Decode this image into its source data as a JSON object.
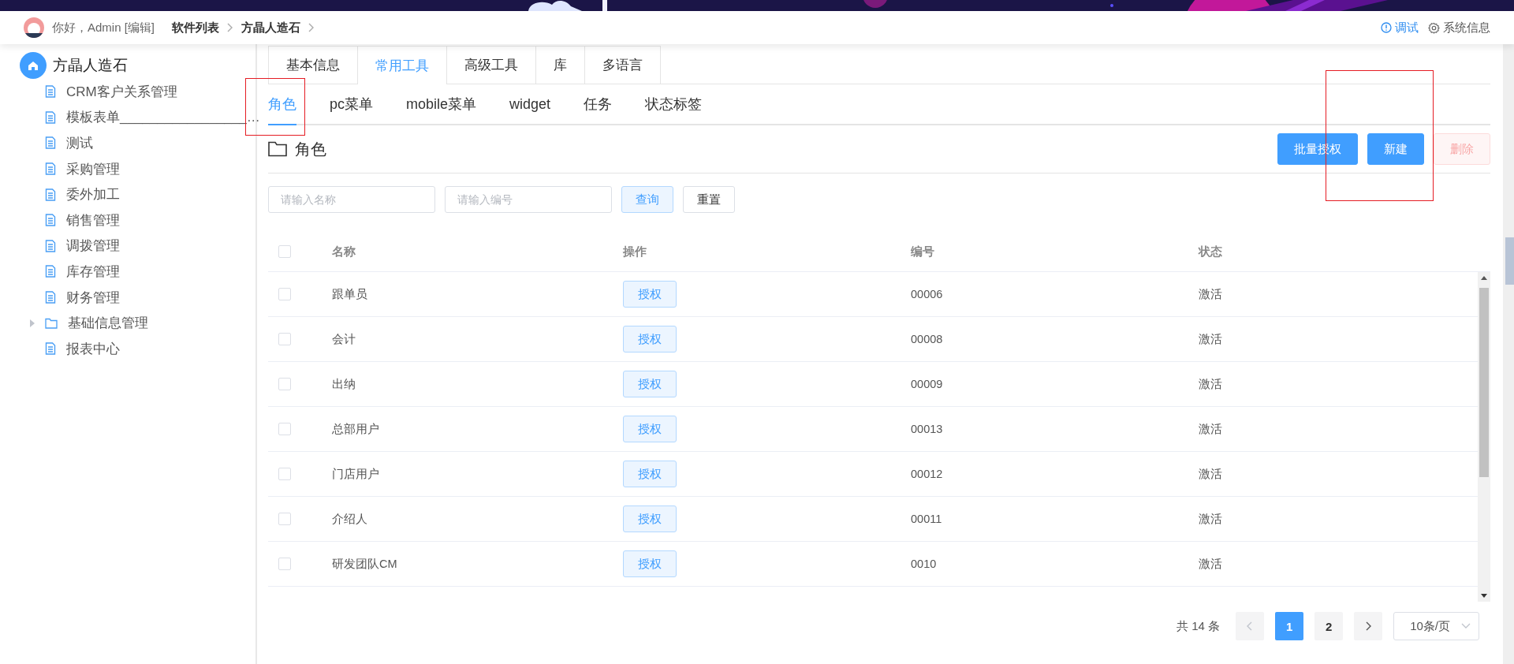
{
  "header": {
    "greeting": "你好，Admin [编辑]",
    "breadcrumb": [
      {
        "label": "软件列表"
      },
      {
        "label": "方晶人造石"
      }
    ],
    "actions": [
      {
        "kind": "info",
        "label": "调试"
      },
      {
        "kind": "gear",
        "label": "系统信息"
      }
    ]
  },
  "sidebar": {
    "root": "方晶人造石",
    "items": [
      {
        "kind": "file",
        "label": "CRM客户关系管理"
      },
      {
        "kind": "file",
        "label": "模板表单_________________…"
      },
      {
        "kind": "file",
        "label": "测试"
      },
      {
        "kind": "file",
        "label": "采购管理"
      },
      {
        "kind": "file",
        "label": "委外加工"
      },
      {
        "kind": "file",
        "label": "销售管理"
      },
      {
        "kind": "file",
        "label": "调拨管理"
      },
      {
        "kind": "file",
        "label": "库存管理"
      },
      {
        "kind": "file",
        "label": "财务管理"
      },
      {
        "kind": "folder",
        "label": "基础信息管理",
        "expanded": false
      },
      {
        "kind": "file",
        "label": "报表中心"
      }
    ]
  },
  "tabs": [
    {
      "label": "基本信息",
      "selected": false
    },
    {
      "label": "常用工具",
      "selected": true
    },
    {
      "label": "高级工具",
      "selected": false
    },
    {
      "label": "库",
      "selected": false
    },
    {
      "label": "多语言",
      "selected": false
    }
  ],
  "subtabs": [
    {
      "label": "角色",
      "selected": true
    },
    {
      "label": "pc菜单",
      "selected": false
    },
    {
      "label": "mobile菜单",
      "selected": false
    },
    {
      "label": "widget",
      "selected": false
    },
    {
      "label": "任务",
      "selected": false
    },
    {
      "label": "状态标签",
      "selected": false
    }
  ],
  "panel": {
    "title": "角色",
    "buttons": [
      {
        "kind": "primary",
        "label": "批量授权"
      },
      {
        "kind": "primary",
        "label": "新建"
      },
      {
        "kind": "danger",
        "label": "删除",
        "disabled": true
      }
    ]
  },
  "filters": {
    "fields": [
      {
        "placeholder": "请输入名称"
      },
      {
        "placeholder": "请输入编号"
      }
    ],
    "buttons": [
      {
        "kind": "query",
        "label": "查询"
      },
      {
        "kind": "plain",
        "label": "重置"
      }
    ]
  },
  "table": {
    "select_all_checked": false,
    "columns": [
      "名称",
      "操作",
      "编号",
      "状态"
    ],
    "rows": [
      {
        "checked": false,
        "name": "跟单员",
        "action": "授权",
        "code": "00006",
        "status": "激活"
      },
      {
        "checked": false,
        "name": "会计",
        "action": "授权",
        "code": "00008",
        "status": "激活"
      },
      {
        "checked": false,
        "name": "出纳",
        "action": "授权",
        "code": "00009",
        "status": "激活"
      },
      {
        "checked": false,
        "name": "总部用户",
        "action": "授权",
        "code": "00013",
        "status": "激活"
      },
      {
        "checked": false,
        "name": "门店用户",
        "action": "授权",
        "code": "00012",
        "status": "激活"
      },
      {
        "checked": false,
        "name": "介绍人",
        "action": "授权",
        "code": "00011",
        "status": "激活"
      },
      {
        "checked": false,
        "name": "研发团队CM",
        "action": "授权",
        "code": "0010",
        "status": "激活"
      }
    ]
  },
  "pagination": {
    "total": "共 14 条",
    "pages": [
      {
        "label": "1",
        "selected": true
      },
      {
        "label": "2",
        "selected": false
      }
    ],
    "page_size": "10条/页"
  }
}
